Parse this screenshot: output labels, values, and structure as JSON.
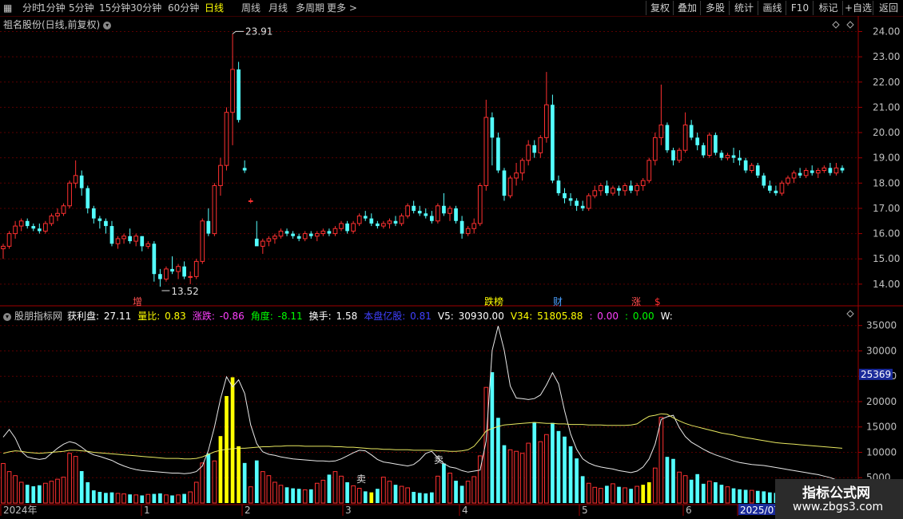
{
  "toolbar": {
    "timeframes": [
      "分时",
      "1分钟",
      "5分钟",
      "15分钟",
      "30分钟",
      "60分钟",
      "日线",
      "周线",
      "月线",
      "多周期",
      "更多 >"
    ],
    "active": "日线",
    "buttons": [
      "复权",
      "叠加",
      "多股",
      "统计",
      "画线",
      "F10",
      "标记",
      "+自选",
      "返回"
    ]
  },
  "header": {
    "stock_label": "祖名股份(日线,前复权)"
  },
  "price_axis": [
    "24.00",
    "23.00",
    "22.00",
    "21.00",
    "20.00",
    "19.00",
    "18.00",
    "17.00",
    "16.00",
    "15.00",
    "14.00"
  ],
  "annotations": {
    "high": "23.91",
    "low": "13.52"
  },
  "event_markers": [
    {
      "text": "增",
      "color": "#ff5050"
    },
    {
      "text": "跌榜",
      "color": "#ffff00"
    },
    {
      "text": "财",
      "color": "#4aa0ff"
    },
    {
      "text": "涨",
      "color": "#ff5050"
    },
    {
      "text": "$",
      "color": "#ff3030"
    }
  ],
  "indicator": {
    "name": "股朋指标网",
    "items": [
      {
        "label": "获利盘:",
        "value": "27.11",
        "color": "#ffffff"
      },
      {
        "label": "量比:",
        "value": "0.83",
        "color": "#ffff00"
      },
      {
        "label": "涨跌:",
        "value": "-0.86",
        "color": "#ff40ff"
      },
      {
        "label": "角度:",
        "value": "-8.11",
        "color": "#00ff00"
      },
      {
        "label": "换手:",
        "value": "1.58",
        "color": "#ffffff"
      },
      {
        "label": "本盘亿股:",
        "value": "0.81",
        "color": "#4040ff"
      },
      {
        "label": "V5:",
        "value": "30930.00",
        "color": "#ffffff"
      },
      {
        "label": "V34:",
        "value": "51805.88",
        "color": "#ffff00"
      },
      {
        "label": ":",
        "value": "0.00",
        "color": "#ff40ff"
      },
      {
        "label": ":",
        "value": "0.00",
        "color": "#00ff00"
      },
      {
        "label": "W:",
        "value": "",
        "color": "#ffffff"
      }
    ]
  },
  "volume_axis": [
    "35000",
    "30000",
    "25000",
    "20000",
    "15000",
    "10000",
    "5000"
  ],
  "volume_marker": "25369",
  "signals": [
    "卖",
    "卖"
  ],
  "date_axis": [
    "2024年",
    "1",
    "2",
    "3",
    "4",
    "5",
    "6",
    "2025/07"
  ],
  "watermark": {
    "title": "指标公式网",
    "url": "www.zbgs3.com"
  },
  "chart_data": {
    "type": "candlestick",
    "ylim": [
      13.3,
      24.3
    ],
    "volume_ylim": [
      0,
      37000
    ],
    "candles": [
      [
        15.4,
        15.6,
        15.0,
        15.5
      ],
      [
        15.5,
        16.1,
        15.4,
        16.0
      ],
      [
        16.0,
        16.5,
        15.8,
        16.3
      ],
      [
        16.3,
        16.6,
        16.1,
        16.5
      ],
      [
        16.5,
        16.6,
        16.2,
        16.3
      ],
      [
        16.3,
        16.4,
        16.1,
        16.2
      ],
      [
        16.2,
        16.4,
        16.0,
        16.1
      ],
      [
        16.1,
        16.5,
        16.0,
        16.4
      ],
      [
        16.4,
        16.8,
        16.3,
        16.7
      ],
      [
        16.7,
        17.0,
        16.5,
        16.8
      ],
      [
        16.8,
        17.2,
        16.7,
        17.1
      ],
      [
        17.1,
        18.1,
        17.0,
        18.0
      ],
      [
        18.0,
        18.9,
        17.8,
        18.3
      ],
      [
        18.3,
        18.5,
        17.5,
        17.8
      ],
      [
        17.8,
        17.9,
        16.8,
        17.0
      ],
      [
        17.0,
        17.1,
        16.4,
        16.6
      ],
      [
        16.6,
        16.7,
        16.2,
        16.5
      ],
      [
        16.5,
        16.6,
        16.0,
        16.3
      ],
      [
        16.3,
        16.5,
        15.5,
        15.6
      ],
      [
        15.6,
        15.9,
        15.4,
        15.8
      ],
      [
        15.8,
        16.0,
        15.6,
        15.9
      ],
      [
        15.9,
        16.2,
        15.6,
        15.7
      ],
      [
        15.7,
        16.0,
        15.5,
        15.9
      ],
      [
        15.9,
        15.9,
        15.3,
        15.5
      ],
      [
        15.5,
        15.7,
        15.4,
        15.6
      ],
      [
        15.6,
        15.7,
        14.1,
        14.4
      ],
      [
        14.4,
        14.6,
        13.9,
        14.2
      ],
      [
        14.2,
        14.7,
        14.1,
        14.6
      ],
      [
        14.6,
        15.1,
        14.4,
        14.5
      ],
      [
        14.5,
        14.8,
        14.2,
        14.7
      ],
      [
        14.7,
        14.9,
        14.2,
        14.3
      ],
      [
        14.3,
        14.5,
        14.0,
        14.3
      ],
      [
        14.3,
        15.0,
        14.2,
        14.9
      ],
      [
        14.9,
        16.6,
        14.8,
        16.5
      ],
      [
        16.5,
        17.0,
        15.9,
        16.0
      ],
      [
        16.0,
        18.0,
        15.9,
        17.9
      ],
      [
        17.9,
        19.0,
        17.5,
        18.7
      ],
      [
        18.7,
        21.0,
        18.5,
        20.8
      ],
      [
        20.8,
        23.91,
        19.5,
        22.5
      ],
      [
        22.5,
        22.8,
        20.4,
        20.5
      ],
      [
        18.6,
        18.9,
        18.4,
        18.5
      ],
      [
        17.3,
        17.4,
        17.2,
        17.3
      ],
      [
        15.8,
        16.5,
        15.6,
        15.5
      ],
      [
        15.5,
        15.8,
        15.2,
        15.7
      ],
      [
        15.7,
        15.9,
        15.5,
        15.8
      ],
      [
        15.8,
        16.0,
        15.6,
        15.9
      ],
      [
        15.9,
        16.2,
        15.8,
        16.1
      ],
      [
        16.1,
        16.2,
        15.9,
        16.0
      ],
      [
        16.0,
        16.1,
        15.8,
        15.9
      ],
      [
        15.9,
        16.0,
        15.7,
        15.8
      ],
      [
        15.8,
        16.1,
        15.7,
        16.0
      ],
      [
        16.0,
        16.1,
        15.8,
        15.9
      ],
      [
        15.9,
        16.1,
        15.7,
        16.0
      ],
      [
        16.0,
        16.2,
        15.9,
        16.1
      ],
      [
        16.1,
        16.2,
        15.9,
        16.0
      ],
      [
        16.0,
        16.3,
        15.9,
        16.2
      ],
      [
        16.2,
        16.5,
        16.1,
        16.4
      ],
      [
        16.4,
        16.5,
        16.0,
        16.1
      ],
      [
        16.1,
        16.5,
        16.0,
        16.4
      ],
      [
        16.4,
        16.8,
        16.3,
        16.7
      ],
      [
        16.7,
        16.9,
        16.5,
        16.6
      ],
      [
        16.6,
        16.8,
        16.3,
        16.4
      ],
      [
        16.4,
        16.5,
        16.2,
        16.3
      ],
      [
        16.3,
        16.5,
        16.2,
        16.4
      ],
      [
        16.4,
        16.6,
        16.2,
        16.5
      ],
      [
        16.5,
        16.7,
        16.3,
        16.4
      ],
      [
        16.4,
        16.8,
        16.3,
        16.7
      ],
      [
        16.7,
        17.2,
        16.6,
        17.1
      ],
      [
        17.1,
        17.3,
        16.8,
        16.9
      ],
      [
        16.9,
        17.1,
        16.7,
        16.8
      ],
      [
        16.8,
        17.0,
        16.6,
        16.7
      ],
      [
        16.7,
        16.9,
        16.4,
        16.5
      ],
      [
        16.5,
        17.2,
        16.4,
        17.1
      ],
      [
        17.1,
        17.6,
        16.7,
        16.8
      ],
      [
        16.8,
        17.1,
        16.5,
        17.0
      ],
      [
        17.0,
        17.1,
        16.4,
        16.5
      ],
      [
        16.5,
        16.7,
        15.8,
        16.0
      ],
      [
        16.0,
        16.3,
        15.9,
        16.2
      ],
      [
        16.2,
        16.6,
        16.0,
        16.4
      ],
      [
        16.4,
        18.0,
        16.3,
        17.9
      ],
      [
        17.9,
        21.3,
        17.7,
        20.6
      ],
      [
        20.6,
        20.8,
        18.7,
        19.8
      ],
      [
        19.8,
        20.0,
        18.4,
        18.5
      ],
      [
        18.5,
        18.6,
        17.3,
        17.5
      ],
      [
        17.5,
        18.3,
        17.4,
        18.2
      ],
      [
        18.2,
        18.8,
        17.9,
        18.4
      ],
      [
        18.4,
        19.0,
        18.1,
        18.9
      ],
      [
        18.9,
        19.7,
        18.7,
        19.5
      ],
      [
        19.5,
        19.7,
        19.0,
        19.2
      ],
      [
        19.2,
        19.9,
        19.0,
        19.8
      ],
      [
        19.8,
        22.4,
        19.6,
        21.1
      ],
      [
        21.1,
        21.5,
        18.0,
        18.1
      ],
      [
        18.1,
        18.3,
        17.5,
        17.6
      ],
      [
        17.6,
        17.8,
        17.2,
        17.4
      ],
      [
        17.4,
        17.6,
        17.1,
        17.3
      ],
      [
        17.3,
        17.4,
        16.9,
        17.1
      ],
      [
        17.1,
        17.3,
        16.9,
        17.0
      ],
      [
        17.0,
        17.6,
        16.9,
        17.5
      ],
      [
        17.5,
        17.9,
        17.4,
        17.7
      ],
      [
        17.7,
        18.0,
        17.5,
        17.9
      ],
      [
        17.9,
        18.1,
        17.5,
        17.6
      ],
      [
        17.6,
        17.9,
        17.5,
        17.8
      ],
      [
        17.8,
        17.9,
        17.5,
        17.7
      ],
      [
        17.7,
        18.0,
        17.5,
        17.9
      ],
      [
        17.9,
        18.1,
        17.6,
        17.7
      ],
      [
        17.7,
        18.0,
        17.5,
        17.9
      ],
      [
        17.9,
        18.2,
        17.7,
        18.1
      ],
      [
        18.1,
        19.0,
        18.0,
        18.9
      ],
      [
        18.9,
        20.0,
        18.7,
        19.8
      ],
      [
        19.8,
        21.9,
        19.5,
        20.3
      ],
      [
        20.3,
        20.4,
        19.2,
        19.3
      ],
      [
        19.3,
        19.4,
        18.7,
        18.9
      ],
      [
        18.9,
        19.4,
        18.8,
        19.3
      ],
      [
        19.3,
        20.8,
        19.2,
        20.3
      ],
      [
        20.3,
        20.5,
        19.7,
        19.8
      ],
      [
        19.8,
        20.0,
        19.3,
        19.5
      ],
      [
        19.5,
        19.6,
        19.0,
        19.1
      ],
      [
        19.1,
        20.0,
        19.0,
        19.9
      ],
      [
        19.9,
        20.0,
        19.1,
        19.2
      ],
      [
        19.2,
        19.3,
        18.9,
        19.0
      ],
      [
        19.0,
        19.2,
        18.9,
        19.1
      ],
      [
        19.1,
        19.4,
        18.8,
        19.0
      ],
      [
        19.0,
        19.3,
        18.7,
        18.9
      ],
      [
        18.9,
        19.0,
        18.4,
        18.5
      ],
      [
        18.5,
        18.8,
        18.4,
        18.7
      ],
      [
        18.7,
        18.8,
        18.2,
        18.3
      ],
      [
        18.3,
        18.4,
        17.8,
        17.9
      ],
      [
        17.9,
        18.1,
        17.6,
        17.7
      ],
      [
        17.7,
        17.9,
        17.5,
        17.6
      ],
      [
        17.6,
        18.1,
        17.5,
        18.0
      ],
      [
        18.0,
        18.3,
        17.9,
        18.2
      ],
      [
        18.2,
        18.5,
        18.0,
        18.4
      ],
      [
        18.4,
        18.6,
        18.2,
        18.3
      ],
      [
        18.3,
        18.6,
        18.2,
        18.5
      ],
      [
        18.5,
        18.7,
        18.3,
        18.4
      ],
      [
        18.4,
        18.6,
        18.2,
        18.5
      ],
      [
        18.5,
        18.7,
        18.4,
        18.6
      ],
      [
        18.6,
        18.8,
        18.3,
        18.4
      ],
      [
        18.4,
        18.8,
        18.3,
        18.6
      ],
      [
        18.6,
        18.7,
        18.4,
        18.5
      ]
    ],
    "volume": [
      7800,
      6200,
      5400,
      4100,
      3600,
      3300,
      3500,
      3900,
      4300,
      4700,
      5100,
      9800,
      9200,
      6300,
      4100,
      2500,
      2200,
      2000,
      2100,
      1900,
      1800,
      1700,
      1600,
      1500,
      1700,
      1800,
      1900,
      1600,
      1500,
      1600,
      1800,
      2200,
      4100,
      7900,
      9800,
      8300,
      13200,
      21100,
      24800,
      11200,
      7900,
      3200,
      8400,
      6200,
      5400,
      4100,
      3500,
      3100,
      2900,
      2800,
      2600,
      2700,
      3900,
      4500,
      5600,
      6200,
      5300,
      4100,
      3400,
      2900,
      2300,
      2100,
      2800,
      5100,
      4300,
      3600,
      3300,
      3000,
      2200,
      2000,
      1900,
      2100,
      5300,
      7800,
      5900,
      4400,
      3400,
      4300,
      5200,
      9300,
      22800,
      25800,
      16800,
      11400,
      10500,
      10200,
      9800,
      11800,
      15900,
      12100,
      13500,
      15800,
      14200,
      13100,
      11200,
      8800,
      5300,
      3900,
      3100,
      2900,
      3400,
      3800,
      3200,
      3000,
      2800,
      3300,
      3600,
      4100,
      6900,
      16900,
      9100,
      8700,
      6100,
      5400,
      4600,
      5700,
      3800,
      4300,
      4100,
      3600,
      3200,
      2900,
      2700,
      2600,
      2500,
      2400,
      2300,
      2100,
      2000,
      2500,
      2300,
      2300,
      2200,
      2400,
      2100,
      2200,
      2000,
      1900,
      2100,
      2200
    ],
    "volume_colors": "red=up, cyan=down, yellow=signal bars",
    "signal_bars": [
      36,
      37,
      38,
      39,
      61,
      106,
      107
    ],
    "lines": [
      {
        "name": "获利盘",
        "values": [
          13000,
          14500,
          12800,
          10200,
          9100,
          8800,
          8600,
          8800,
          9800,
          10800,
          11600,
          12100,
          11800,
          11000,
          10100,
          9500,
          9200,
          8800,
          8400,
          7800,
          7300,
          6900,
          6600,
          6400,
          6300,
          6200,
          6100,
          6000,
          5900,
          5900,
          5800,
          5900,
          6200,
          7300,
          10400,
          15000,
          20500,
          24900,
          22900,
          24300,
          21600,
          15400,
          11700,
          10100,
          9600,
          9400,
          9100,
          8900,
          8700,
          8600,
          8500,
          8400,
          8300,
          8300,
          8200,
          8300,
          8700,
          9300,
          9900,
          10400,
          10300,
          9500,
          8600,
          8100,
          7900,
          7700,
          7500,
          7300,
          7600,
          8500,
          9800,
          10200,
          8900,
          7800,
          7100,
          6900,
          6400,
          6100,
          6300,
          6500,
          12200,
          30100,
          34900,
          30100,
          23100,
          20700,
          20600,
          20400,
          20600,
          21300,
          23300,
          25700,
          23500,
          18200,
          13600,
          10600,
          8700,
          7900,
          7400,
          7100,
          6900,
          6700,
          6400,
          6200,
          6000,
          6300,
          7100,
          8700,
          11600,
          16500,
          17000,
          17300,
          14900,
          13100,
          12000,
          11300,
          10600,
          10000,
          9500,
          9100,
          8700,
          8300,
          8000,
          7800,
          7600,
          7500,
          7400,
          7200,
          7000,
          6800,
          6600,
          6400,
          6200,
          6000,
          5800,
          5600,
          5300,
          5000,
          4600,
          4200
        ]
      },
      {
        "name": "V34",
        "values": [
          9800,
          10100,
          10300,
          10200,
          10000,
          9900,
          9800,
          9900,
          10000,
          10100,
          10200,
          10400,
          10400,
          10300,
          10200,
          10000,
          9900,
          9800,
          9700,
          9600,
          9500,
          9400,
          9300,
          9200,
          9100,
          9000,
          8900,
          8800,
          8800,
          8800,
          8700,
          8700,
          8800,
          9100,
          9600,
          10100,
          10400,
          10600,
          10700,
          10800,
          10800,
          10900,
          11000,
          11100,
          11100,
          11200,
          11200,
          11300,
          11300,
          11300,
          11200,
          11200,
          11200,
          11200,
          11200,
          11100,
          11100,
          11000,
          11000,
          10900,
          10800,
          10700,
          10700,
          10600,
          10600,
          10500,
          10500,
          10500,
          10400,
          10400,
          10400,
          10400,
          10300,
          10300,
          10200,
          10200,
          10300,
          10500,
          11200,
          12600,
          14200,
          14700,
          15100,
          15400,
          15500,
          15600,
          15700,
          15800,
          15900,
          15800,
          15700,
          15700,
          15600,
          15600,
          15500,
          15500,
          15500,
          15400,
          15400,
          15400,
          15300,
          15300,
          15300,
          15300,
          15400,
          15600,
          16400,
          17100,
          17300,
          17600,
          17500,
          16800,
          16200,
          15700,
          15300,
          15000,
          14700,
          14400,
          14100,
          13800,
          13600,
          13400,
          13100,
          12900,
          12700,
          12500,
          12300,
          12100,
          11900,
          11800,
          11700,
          11600,
          11500,
          11400,
          11300,
          11200,
          11100,
          11000,
          10900,
          10800
        ]
      }
    ]
  }
}
